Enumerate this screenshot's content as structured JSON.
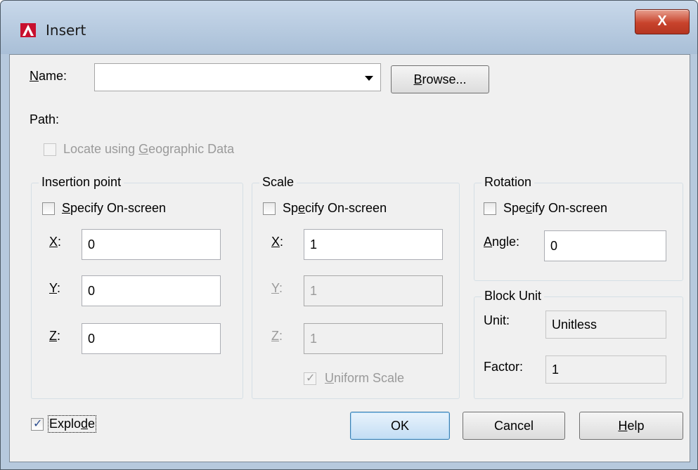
{
  "window": {
    "title": "Insert",
    "close_label": "X"
  },
  "name": {
    "label_u": "N",
    "label_rest": "ame:",
    "value": "",
    "browse_u": "B",
    "browse_rest": "rowse..."
  },
  "path_label": "Path:",
  "geo": {
    "pre": "Locate using ",
    "u": "G",
    "post": "eographic Data",
    "checked": false,
    "enabled": false
  },
  "insertion": {
    "title": "Insertion point",
    "specify": {
      "u": "S",
      "rest": "pecify On-screen",
      "checked": false
    },
    "x": {
      "u": "X",
      "rest": ":",
      "value": "0"
    },
    "y": {
      "u": "Y",
      "rest": ":",
      "value": "0"
    },
    "z": {
      "u": "Z",
      "rest": ":",
      "value": "0"
    }
  },
  "scale": {
    "title": "Scale",
    "specify": {
      "pre": "Sp",
      "u": "e",
      "rest": "cify On-screen",
      "checked": false
    },
    "x": {
      "u": "X",
      "rest": ":",
      "value": "1"
    },
    "y": {
      "u": "Y",
      "rest": ":",
      "value": "1"
    },
    "z": {
      "u": "Z",
      "rest": ":",
      "value": "1"
    },
    "uniform": {
      "u": "U",
      "rest": "niform Scale",
      "checked": true,
      "enabled": false
    }
  },
  "rotation": {
    "title": "Rotation",
    "specify": {
      "pre": "Spe",
      "u": "c",
      "rest": "ify On-screen",
      "checked": false
    },
    "angle": {
      "u": "A",
      "rest": "ngle:",
      "value": "0"
    }
  },
  "block_unit": {
    "title": "Block Unit",
    "unit_label": "Unit:",
    "unit_value": "Unitless",
    "factor_label": "Factor:",
    "factor_value": "1"
  },
  "explode": {
    "pre": "Explo",
    "u": "d",
    "rest": "e",
    "checked": true
  },
  "buttons": {
    "ok": "OK",
    "cancel": "Cancel",
    "help_u": "H",
    "help_rest": "elp"
  },
  "colors": {
    "accent_blue": "#3c7fb1",
    "close_red": "#c8432c",
    "frame": "#b6c9dd"
  }
}
